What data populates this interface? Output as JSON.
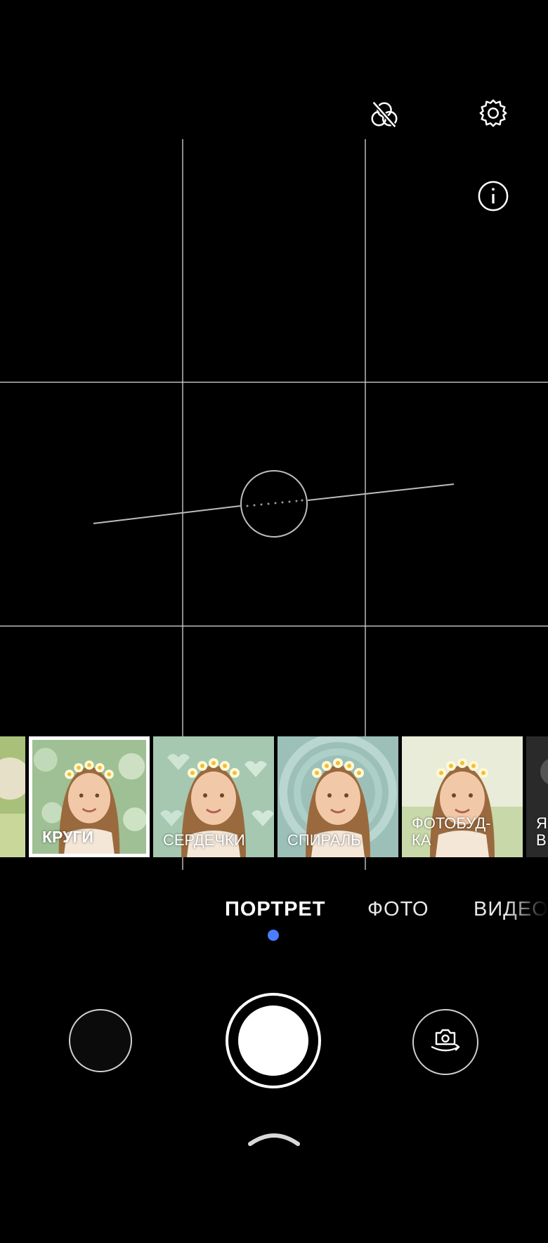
{
  "top_bar": {
    "icons": [
      "filter-off-icon",
      "gear-icon",
      "info-icon"
    ]
  },
  "filters": [
    {
      "label": "",
      "selected": false
    },
    {
      "label": "КРУГИ",
      "selected": true
    },
    {
      "label": "СЕРДЕЧКИ",
      "selected": false
    },
    {
      "label": "СПИРАЛЬ",
      "selected": false
    },
    {
      "label": "ФОТОБУД-\nКА",
      "selected": false
    },
    {
      "label": "Я\nВ",
      "selected": false
    }
  ],
  "modes": {
    "portrait": "ПОРТРЕТ",
    "photo": "ФОТО",
    "video": "ВИДЕО",
    "active": "ПОРТРЕТ"
  },
  "colors": {
    "background": "#000000",
    "mode_indicator": "#4a7dff",
    "grid": "#c8c8c8"
  },
  "controls": {
    "icons": [
      "gallery-icon",
      "shutter-icon",
      "switch-camera-icon",
      "chevron-up-icon"
    ]
  }
}
